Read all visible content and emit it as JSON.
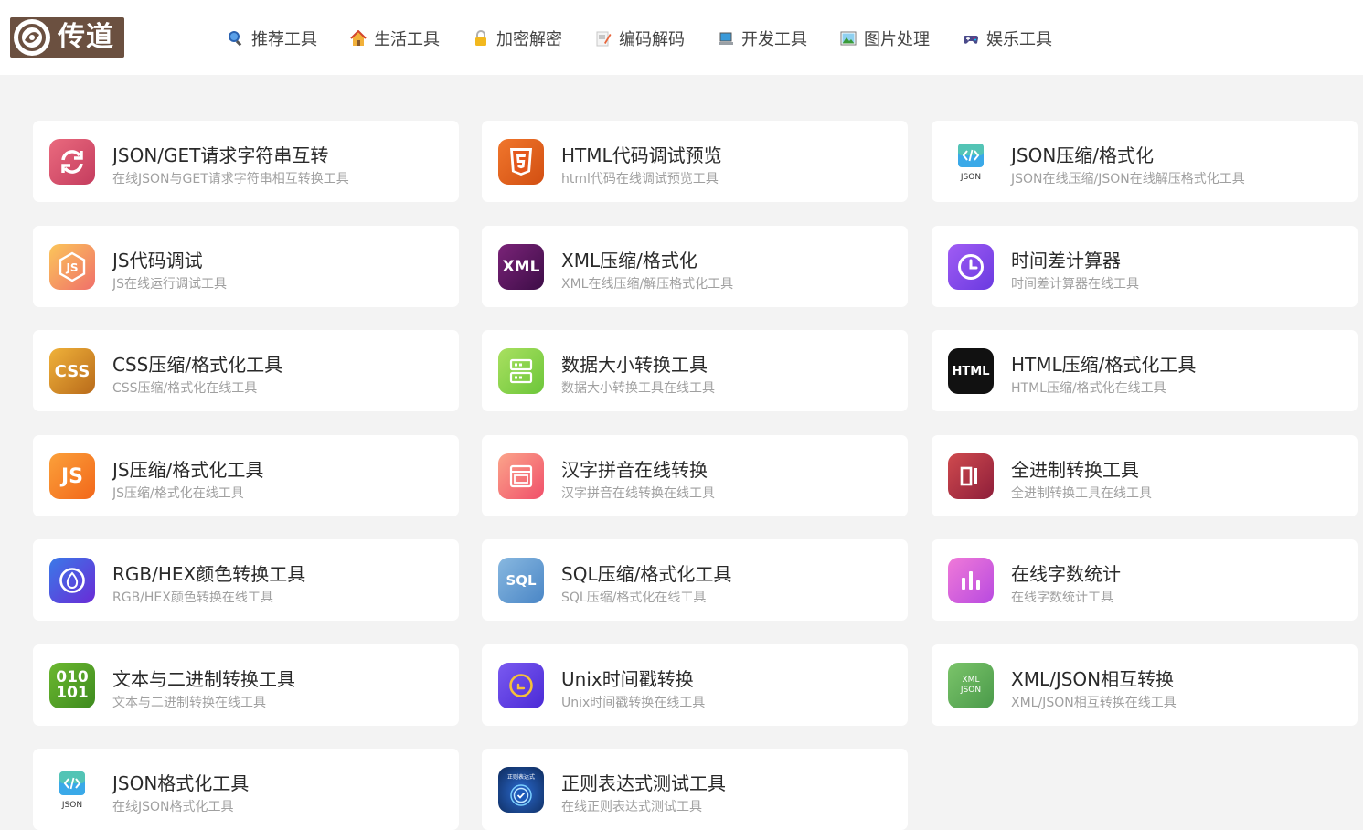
{
  "header": {
    "logo_text": "传道",
    "nav": [
      {
        "label": "推荐工具",
        "icon": "search-icon"
      },
      {
        "label": "生活工具",
        "icon": "house-icon"
      },
      {
        "label": "加密解密",
        "icon": "lock-icon"
      },
      {
        "label": "编码解码",
        "icon": "memo-icon"
      },
      {
        "label": "开发工具",
        "icon": "laptop-icon"
      },
      {
        "label": "图片处理",
        "icon": "picture-icon"
      },
      {
        "label": "娱乐工具",
        "icon": "gamepad-icon"
      }
    ]
  },
  "tools": [
    {
      "title": "JSON/GET请求字符串互转",
      "desc": "在线JSON与GET请求字符串相互转换工具",
      "icon": "refresh-icon",
      "color": "#d9546a"
    },
    {
      "title": "HTML代码调试预览",
      "desc": "html代码在线调试预览工具",
      "icon": "html5-icon",
      "color": "#e0631e"
    },
    {
      "title": "JSON压缩/格式化",
      "desc": "JSON在线压缩/JSON在线解压格式化工具",
      "icon": "json-file-icon",
      "color": "#2f8bd6"
    },
    {
      "title": "JS代码调试",
      "desc": "JS在线运行调试工具",
      "icon": "js-badge-icon",
      "color": "#f79a4a"
    },
    {
      "title": "XML压缩/格式化",
      "desc": "XML在线压缩/解压格式化工具",
      "icon": "xml-icon",
      "color": "#5a1a5e",
      "icon_text": "XML"
    },
    {
      "title": "时间差计算器",
      "desc": "时间差计算器在线工具",
      "icon": "clock-icon",
      "color": "#8a4ef0"
    },
    {
      "title": "CSS压缩/格式化工具",
      "desc": "CSS压缩/格式化在线工具",
      "icon": "css-icon",
      "color": "#d98a22",
      "icon_text": "CSS"
    },
    {
      "title": "数据大小转换工具",
      "desc": "数据大小转换工具在线工具",
      "icon": "storage-icon",
      "color": "#8ed24a"
    },
    {
      "title": "HTML压缩/格式化工具",
      "desc": "HTML压缩/格式化在线工具",
      "icon": "html-text-icon",
      "color": "#1a1a1a",
      "icon_text": "HTML"
    },
    {
      "title": "JS压缩/格式化工具",
      "desc": "JS压缩/格式化在线工具",
      "icon": "js-icon",
      "color": "#f5841e",
      "icon_text": "JS"
    },
    {
      "title": "汉字拼音在线转换",
      "desc": "汉字拼音在线转换在线工具",
      "icon": "document-icon",
      "color": "#f36a7a"
    },
    {
      "title": "全进制转换工具",
      "desc": "全进制转换工具在线工具",
      "icon": "binary-bars-icon",
      "color": "#b8343e"
    },
    {
      "title": "RGB/HEX颜色转换工具",
      "desc": "RGB/HEX颜色转换在线工具",
      "icon": "drop-icon",
      "color": "#4f4de0"
    },
    {
      "title": "SQL压缩/格式化工具",
      "desc": "SQL压缩/格式化在线工具",
      "icon": "sql-icon",
      "color": "#6ca2d6",
      "icon_text": "SQL"
    },
    {
      "title": "在线字数统计",
      "desc": "在线字数统计工具",
      "icon": "bar-chart-icon",
      "color": "#dd56d8"
    },
    {
      "title": "文本与二进制转换工具",
      "desc": "文本与二进制转换在线工具",
      "icon": "binary-icon",
      "color": "#5a9e24",
      "icon_text": "010\n101"
    },
    {
      "title": "Unix时间戳转换",
      "desc": "Unix时间戳转换在线工具",
      "icon": "timer-icon",
      "color": "#6648e8"
    },
    {
      "title": "XML/JSON相互转换",
      "desc": "XML/JSON相互转换在线工具",
      "icon": "xml-json-icon",
      "color": "#62ad5a",
      "icon_text": "XML JSON"
    },
    {
      "title": "JSON格式化工具",
      "desc": "在线JSON格式化工具",
      "icon": "json-file-icon",
      "color": "#2f8bd6"
    },
    {
      "title": "正则表达式测试工具",
      "desc": "在线正则表达式测试工具",
      "icon": "regex-icon",
      "color": "#1c3f7a",
      "icon_text": "正则表达式"
    }
  ]
}
